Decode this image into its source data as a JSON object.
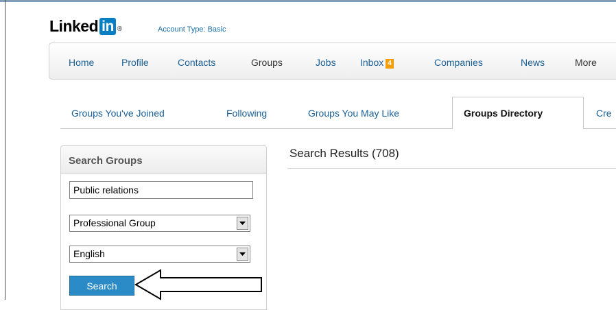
{
  "header": {
    "logo_text": "Linked",
    "logo_box_text": "in",
    "logo_mark": "®",
    "account_type": "Account Type: Basic"
  },
  "nav": {
    "items": [
      {
        "label": "Home"
      },
      {
        "label": "Profile"
      },
      {
        "label": "Contacts"
      },
      {
        "label": "Groups"
      },
      {
        "label": "Jobs"
      },
      {
        "label": "Inbox"
      },
      {
        "label": "Companies"
      },
      {
        "label": "News"
      },
      {
        "label": "More"
      }
    ],
    "inbox_count": "4",
    "inbox_badge_color": "#f49f0a"
  },
  "subtabs": {
    "items": [
      {
        "label": "Groups You've Joined"
      },
      {
        "label": "Following"
      },
      {
        "label": "Groups You May Like"
      },
      {
        "label": "Groups Directory"
      },
      {
        "label": "Cre"
      }
    ],
    "active": "Groups Directory"
  },
  "search_panel": {
    "title": "Search Groups",
    "keyword_value": "Public relations",
    "category_selected": "Professional Group",
    "language_selected": "English",
    "search_button_label": "Search",
    "button_color": "#2b8bc6"
  },
  "results": {
    "title": "Search Results (708)"
  },
  "colors": {
    "link": "#1a5f96",
    "brand": "#0a7ec2"
  }
}
